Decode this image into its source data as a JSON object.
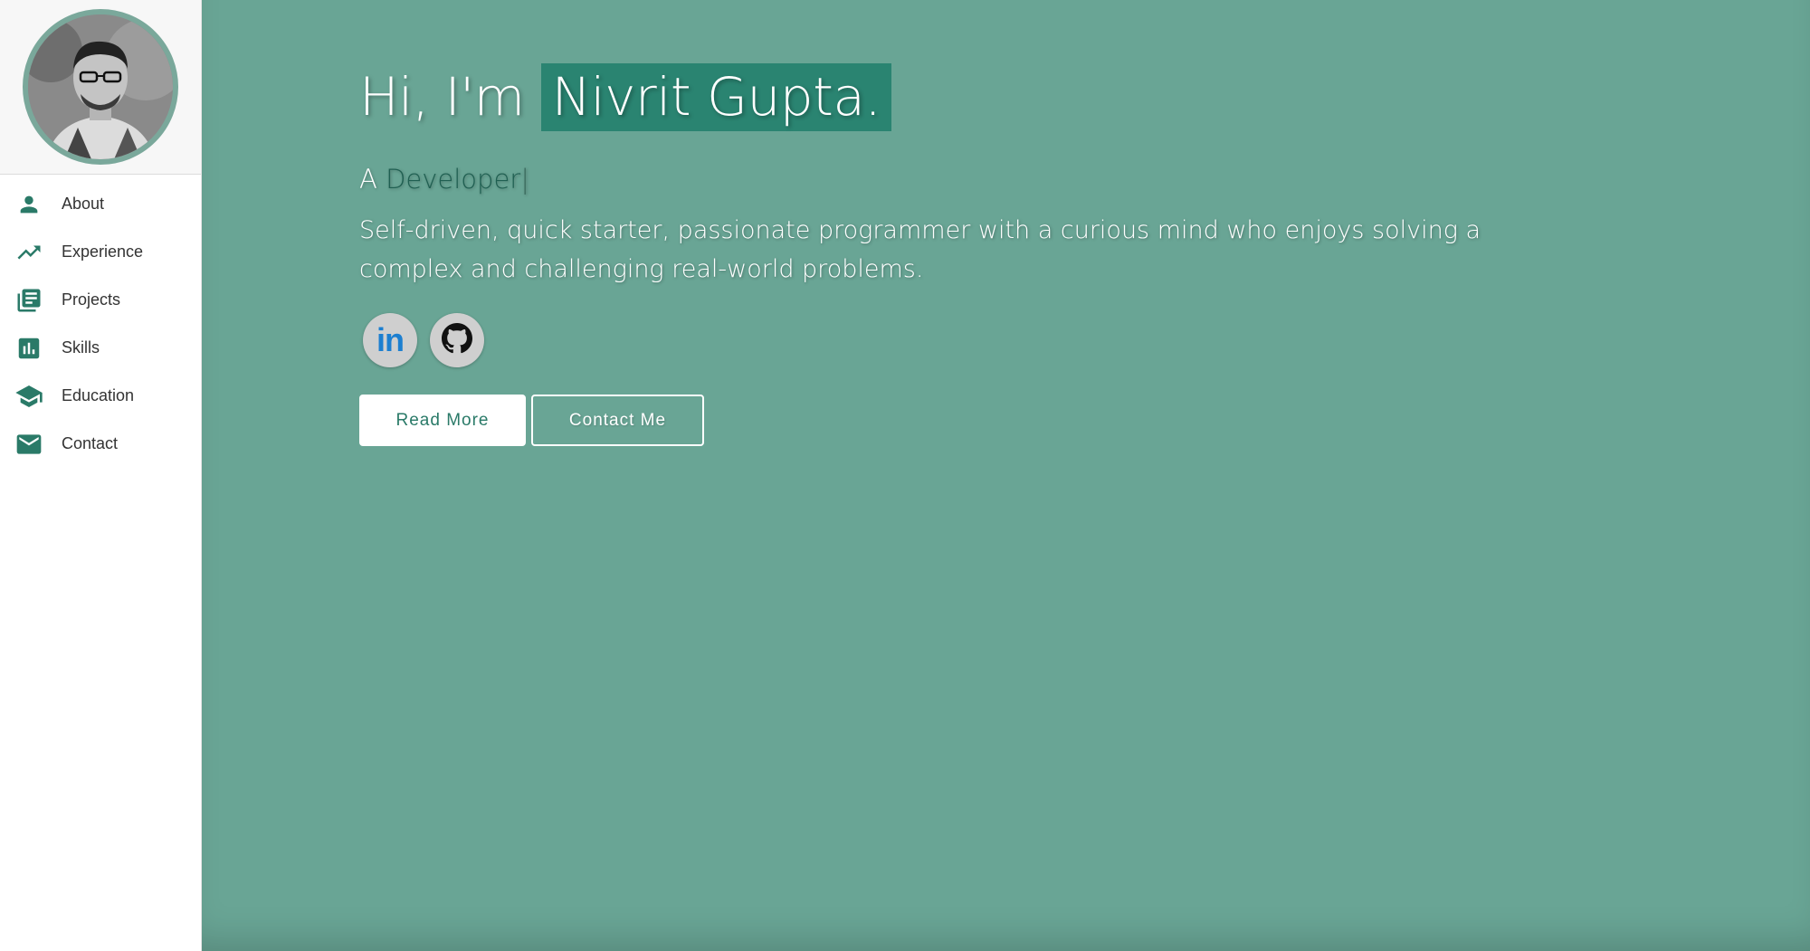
{
  "colors": {
    "accent": "#2a8471",
    "background": "#69a595",
    "sidebar_icon": "#2a7a68"
  },
  "sidebar": {
    "items": [
      {
        "label": "About",
        "icon": "person-icon"
      },
      {
        "label": "Experience",
        "icon": "trending-up-icon"
      },
      {
        "label": "Projects",
        "icon": "library-books-icon"
      },
      {
        "label": "Skills",
        "icon": "bar-chart-icon"
      },
      {
        "label": "Education",
        "icon": "school-icon"
      },
      {
        "label": "Contact",
        "icon": "email-icon"
      }
    ]
  },
  "hero": {
    "greeting": "Hi, I'm ",
    "name": "Nivrit Gupta.",
    "subtitle_prefix": "A ",
    "role": "Developer",
    "cursor": "|",
    "description": "Self-driven, quick starter, passionate programmer with a curious mind who enjoys solving a complex and challenging real-world problems."
  },
  "socials": {
    "linkedin_text": "in",
    "github_icon": "github-icon"
  },
  "buttons": {
    "read_more": "Read More",
    "contact_me": "Contact Me"
  }
}
